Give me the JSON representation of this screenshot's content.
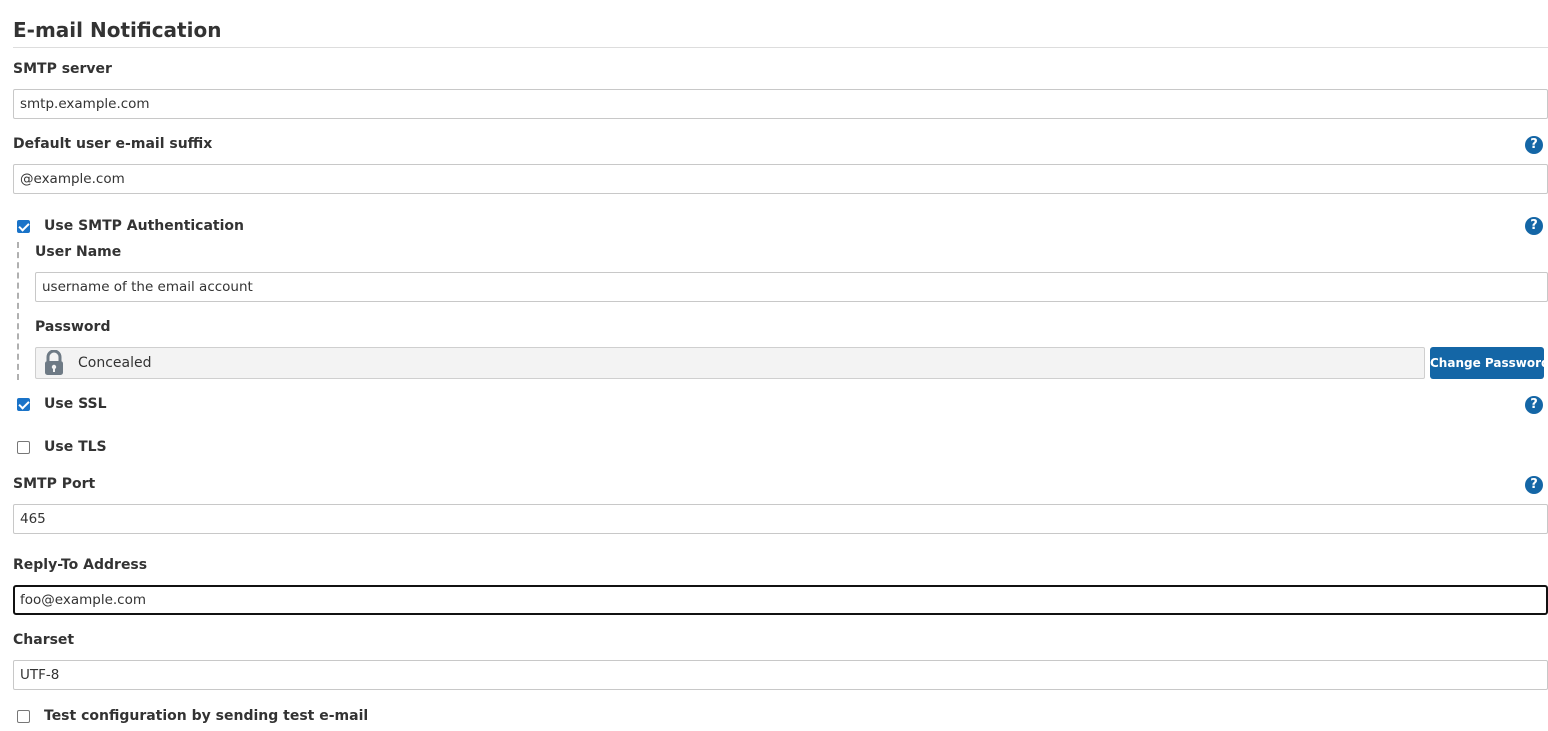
{
  "section": {
    "title": "E-mail Notification"
  },
  "smtp_server": {
    "label": "SMTP server",
    "value": "smtp.example.com"
  },
  "email_suffix": {
    "label": "Default user e-mail suffix",
    "value": "@example.com",
    "help": "?"
  },
  "smtp_auth": {
    "label": "Use SMTP Authentication",
    "checked": true,
    "help": "?",
    "username": {
      "label": "User Name",
      "value": "username of the email account"
    },
    "password": {
      "label": "Password",
      "value": "Concealed",
      "button_label": "Change Password"
    }
  },
  "use_ssl": {
    "label": "Use SSL",
    "checked": true,
    "help": "?"
  },
  "use_tls": {
    "label": "Use TLS",
    "checked": false
  },
  "smtp_port": {
    "label": "SMTP Port",
    "value": "465",
    "help": "?"
  },
  "reply_to": {
    "label": "Reply-To Address",
    "value": "foo@example.com"
  },
  "charset": {
    "label": "Charset",
    "value": "UTF-8"
  },
  "test_config": {
    "label": "Test configuration by sending test e-mail",
    "checked": false
  },
  "colors": {
    "accent": "#1466a6",
    "checkbox_checked": "#1a73c8",
    "focus_border": "#111111"
  },
  "icons": {
    "help": "question-circle-icon",
    "lock": "lock-icon",
    "checkbox": "checkbox"
  }
}
